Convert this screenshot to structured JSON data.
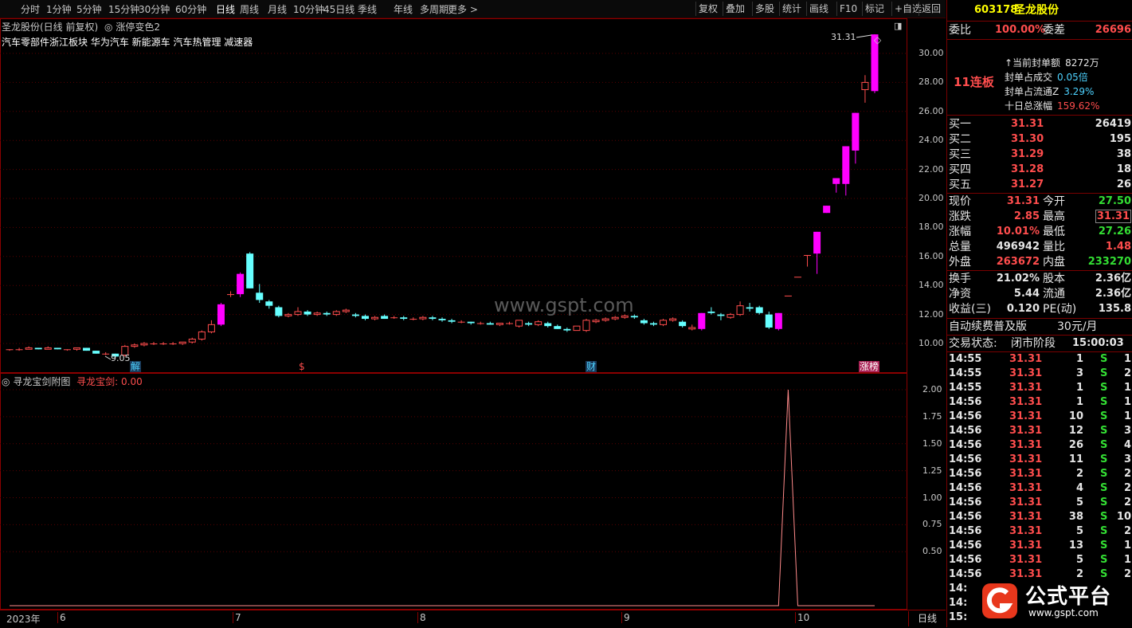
{
  "toolbar": {
    "periods": [
      "分时",
      "1分钟",
      "5分钟",
      "15分钟",
      "30分钟",
      "60分钟",
      "日线",
      "周线",
      "月线",
      "10分钟",
      "45日线",
      "季线",
      "年线",
      "多周期",
      "更多 >"
    ],
    "buttons": [
      "复权",
      "叠加",
      "多股",
      "统计",
      "画线",
      "F10",
      "标记",
      "+自选",
      "返回"
    ]
  },
  "chart": {
    "title": "圣龙股份(日线 前复权)",
    "indicator": "涨停变色2",
    "concepts": "汽车零部件浙江板块  华为汽车 新能源车 汽车热管理 减速器",
    "watermark": "www.gspt.com",
    "max_label": "31.31",
    "min_label": "9.05",
    "y_ticks": [
      "30.00",
      "28.00",
      "26.00",
      "24.00",
      "22.00",
      "20.00",
      "18.00",
      "16.00",
      "14.00",
      "12.00",
      "10.00"
    ],
    "markers": [
      "解",
      "$",
      "财",
      "涨榜"
    ],
    "candles_note": "daily candles",
    "candles": [
      [
        9.6,
        9.6,
        9.5,
        9.6
      ],
      [
        9.6,
        9.7,
        9.5,
        9.6
      ],
      [
        9.6,
        9.8,
        9.6,
        9.7
      ],
      [
        9.7,
        9.7,
        9.6,
        9.6
      ],
      [
        9.6,
        9.8,
        9.6,
        9.7
      ],
      [
        9.7,
        9.7,
        9.6,
        9.6
      ],
      [
        9.6,
        9.6,
        9.5,
        9.6
      ],
      [
        9.6,
        9.7,
        9.5,
        9.7
      ],
      [
        9.7,
        9.7,
        9.5,
        9.5
      ],
      [
        9.5,
        9.5,
        9.3,
        9.3
      ],
      [
        9.3,
        9.4,
        9.2,
        9.3
      ],
      [
        9.3,
        9.3,
        9.05,
        9.1
      ],
      [
        9.2,
        9.9,
        9.1,
        9.8
      ],
      [
        9.8,
        10.0,
        9.7,
        9.9
      ],
      [
        9.9,
        10.1,
        9.8,
        10.0
      ],
      [
        10.0,
        10.1,
        9.9,
        10.0
      ],
      [
        10.0,
        10.1,
        9.9,
        10.0
      ],
      [
        10.0,
        10.1,
        9.9,
        10.0
      ],
      [
        10.0,
        10.1,
        9.9,
        10.1
      ],
      [
        10.1,
        10.4,
        10.0,
        10.3
      ],
      [
        10.3,
        10.9,
        10.2,
        10.8
      ],
      [
        10.8,
        11.6,
        10.7,
        11.3
      ],
      [
        11.3,
        12.8,
        11.2,
        12.7
      ],
      [
        13.4,
        13.6,
        13.2,
        13.4
      ],
      [
        13.4,
        14.9,
        13.2,
        14.8
      ],
      [
        16.2,
        16.3,
        13.8,
        13.8
      ],
      [
        13.5,
        14.1,
        12.8,
        13.0
      ],
      [
        12.9,
        13.0,
        12.4,
        12.6
      ],
      [
        12.5,
        12.6,
        11.8,
        11.9
      ],
      [
        11.9,
        12.1,
        11.8,
        12.0
      ],
      [
        12.0,
        12.5,
        11.9,
        12.2
      ],
      [
        12.2,
        12.3,
        11.9,
        12.0
      ],
      [
        12.0,
        12.2,
        11.9,
        12.1
      ],
      [
        12.1,
        12.2,
        11.9,
        12.0
      ],
      [
        12.0,
        12.3,
        11.9,
        12.2
      ],
      [
        12.2,
        12.4,
        12.1,
        12.3
      ],
      [
        12.0,
        12.1,
        11.8,
        11.9
      ],
      [
        11.9,
        12.0,
        11.6,
        11.7
      ],
      [
        11.7,
        11.9,
        11.6,
        11.8
      ],
      [
        11.9,
        12.0,
        11.7,
        11.7
      ],
      [
        11.8,
        11.9,
        11.7,
        11.8
      ],
      [
        11.8,
        11.9,
        11.6,
        11.7
      ],
      [
        11.7,
        11.8,
        11.6,
        11.7
      ],
      [
        11.7,
        11.9,
        11.6,
        11.8
      ],
      [
        11.8,
        11.9,
        11.6,
        11.7
      ],
      [
        11.7,
        11.8,
        11.5,
        11.6
      ],
      [
        11.6,
        11.7,
        11.4,
        11.5
      ],
      [
        11.5,
        11.6,
        11.4,
        11.5
      ],
      [
        11.5,
        11.5,
        11.3,
        11.4
      ],
      [
        11.4,
        11.5,
        11.3,
        11.4
      ],
      [
        11.4,
        11.5,
        11.3,
        11.3
      ],
      [
        11.3,
        11.4,
        11.2,
        11.4
      ],
      [
        11.4,
        11.5,
        11.3,
        11.4
      ],
      [
        11.2,
        11.6,
        11.1,
        11.6
      ],
      [
        11.4,
        11.5,
        11.2,
        11.3
      ],
      [
        11.3,
        11.6,
        11.2,
        11.5
      ],
      [
        11.4,
        11.5,
        11.1,
        11.2
      ],
      [
        11.2,
        11.3,
        11.0,
        11.0
      ],
      [
        11.0,
        11.1,
        10.8,
        10.9
      ],
      [
        10.9,
        11.2,
        10.9,
        11.2
      ],
      [
        10.9,
        11.7,
        10.8,
        11.6
      ],
      [
        11.5,
        11.7,
        11.4,
        11.6
      ],
      [
        11.6,
        11.8,
        11.5,
        11.7
      ],
      [
        11.7,
        11.9,
        11.6,
        11.8
      ],
      [
        11.8,
        12.0,
        11.7,
        11.9
      ],
      [
        11.9,
        12.0,
        11.7,
        11.8
      ],
      [
        11.6,
        11.7,
        11.3,
        11.4
      ],
      [
        11.4,
        11.5,
        11.2,
        11.3
      ],
      [
        11.3,
        11.7,
        11.2,
        11.6
      ],
      [
        11.6,
        11.8,
        11.5,
        11.7
      ],
      [
        11.5,
        11.6,
        11.1,
        11.2
      ],
      [
        11.0,
        11.3,
        10.9,
        11.1
      ],
      [
        11.0,
        12.1,
        10.9,
        12.1
      ],
      [
        12.2,
        12.5,
        12.0,
        12.1
      ],
      [
        12.0,
        12.1,
        11.6,
        11.9
      ],
      [
        11.8,
        12.1,
        11.7,
        12.0
      ],
      [
        12.0,
        12.9,
        11.9,
        12.6
      ],
      [
        12.5,
        12.8,
        12.2,
        12.4
      ],
      [
        12.5,
        12.6,
        12.0,
        12.1
      ],
      [
        12.0,
        12.2,
        11.0,
        11.1
      ],
      [
        11.0,
        12.1,
        10.9,
        12.1
      ],
      [
        13.3,
        13.3,
        13.3,
        13.3
      ],
      [
        14.6,
        14.6,
        14.6,
        14.6
      ],
      [
        16.1,
        16.1,
        15.3,
        16.1
      ],
      [
        16.2,
        17.7,
        14.8,
        17.7
      ],
      [
        19.0,
        19.5,
        19.0,
        19.5
      ],
      [
        21.0,
        21.4,
        20.4,
        21.4
      ],
      [
        21.0,
        23.6,
        20.2,
        23.6
      ],
      [
        23.3,
        25.9,
        22.4,
        25.9
      ],
      [
        27.5,
        28.5,
        26.6,
        28.0
      ],
      [
        27.4,
        31.31,
        27.26,
        31.31
      ]
    ]
  },
  "sub": {
    "title": "寻龙宝剑附图",
    "value_label": "寻龙宝剑: 0.00",
    "y_ticks": [
      "2.00",
      "1.75",
      "1.50",
      "1.25",
      "1.00",
      "0.75",
      "0.50"
    ],
    "spike_index": 81,
    "spike_value": 2.0
  },
  "xaxis": {
    "labels": [
      "2023年",
      "6",
      "7",
      "8",
      "9",
      "10"
    ],
    "period": "日线"
  },
  "panel": {
    "code": "603178",
    "name": "圣龙股份",
    "weibi_label": "委比",
    "weibi_value": "100.00%",
    "weicha_label": "委差",
    "weicha_value": "26696",
    "lianban": "11连板",
    "seal_lines": [
      {
        "label": "当前封单额",
        "value": "8272万"
      },
      {
        "label": "封单占成交",
        "value": "0.05倍"
      },
      {
        "label": "封单占流通Z",
        "value": "3.29%"
      },
      {
        "label": "十日总涨幅",
        "value": "159.62%"
      }
    ],
    "bids": [
      {
        "label": "买一",
        "price": "31.31",
        "vol": "26419"
      },
      {
        "label": "买二",
        "price": "31.30",
        "vol": "195"
      },
      {
        "label": "买三",
        "price": "31.29",
        "vol": "38"
      },
      {
        "label": "买四",
        "price": "31.28",
        "vol": "18"
      },
      {
        "label": "买五",
        "price": "31.27",
        "vol": "26"
      }
    ],
    "quote": [
      {
        "l1": "现价",
        "v1": "31.31",
        "l2": "今开",
        "v2": "27.50"
      },
      {
        "l1": "涨跌",
        "v1": "2.85",
        "l2": "最高",
        "v2": "31.31"
      },
      {
        "l1": "涨幅",
        "v1": "10.01%",
        "l2": "最低",
        "v2": "27.26"
      },
      {
        "l1": "总量",
        "v1": "496942",
        "l2": "量比",
        "v2": "1.48"
      },
      {
        "l1": "外盘",
        "v1": "263672",
        "l2": "内盘",
        "v2": "233270"
      }
    ],
    "fund": [
      {
        "l1": "换手",
        "v1": "21.02%",
        "l2": "股本",
        "v2": "2.36亿"
      },
      {
        "l1": "净资",
        "v1": "5.44",
        "l2": "流通",
        "v2": "2.36亿"
      },
      {
        "l1": "收益(三)",
        "v1": "0.120",
        "l2": "PE(动)",
        "v2": "135.8"
      }
    ],
    "promo": "自动续费普及版",
    "promo_price": "30元/月",
    "status_label": "交易状态:",
    "status_value": "闭市阶段",
    "status_time": "15:00:03",
    "ticks": [
      [
        "14:55",
        "31.31",
        "1",
        "S",
        "1"
      ],
      [
        "14:55",
        "31.31",
        "3",
        "S",
        "2"
      ],
      [
        "14:55",
        "31.31",
        "1",
        "S",
        "1"
      ],
      [
        "14:56",
        "31.31",
        "1",
        "S",
        "1"
      ],
      [
        "14:56",
        "31.31",
        "10",
        "S",
        "1"
      ],
      [
        "14:56",
        "31.31",
        "12",
        "S",
        "3"
      ],
      [
        "14:56",
        "31.31",
        "26",
        "S",
        "4"
      ],
      [
        "14:56",
        "31.31",
        "11",
        "S",
        "3"
      ],
      [
        "14:56",
        "31.31",
        "2",
        "S",
        "2"
      ],
      [
        "14:56",
        "31.31",
        "4",
        "S",
        "2"
      ],
      [
        "14:56",
        "31.31",
        "5",
        "S",
        "2"
      ],
      [
        "14:56",
        "31.31",
        "38",
        "S",
        "10"
      ],
      [
        "14:56",
        "31.31",
        "5",
        "S",
        "2"
      ],
      [
        "14:56",
        "31.31",
        "13",
        "S",
        "1"
      ],
      [
        "14:56",
        "31.31",
        "5",
        "S",
        "1"
      ],
      [
        "14:56",
        "31.31",
        "2",
        "S",
        "2"
      ],
      [
        "14:",
        "",
        "",
        "",
        ""
      ],
      [
        "14:",
        "",
        "",
        "",
        ""
      ],
      [
        "15:",
        "",
        "",
        "",
        ""
      ]
    ],
    "logo_text": "公式平台",
    "logo_url": "www.gspt.com"
  },
  "colors": {
    "up": "#ff00ff",
    "down": "#66ffff",
    "flat": "#ff4d4d",
    "frame": "#8b0000"
  }
}
